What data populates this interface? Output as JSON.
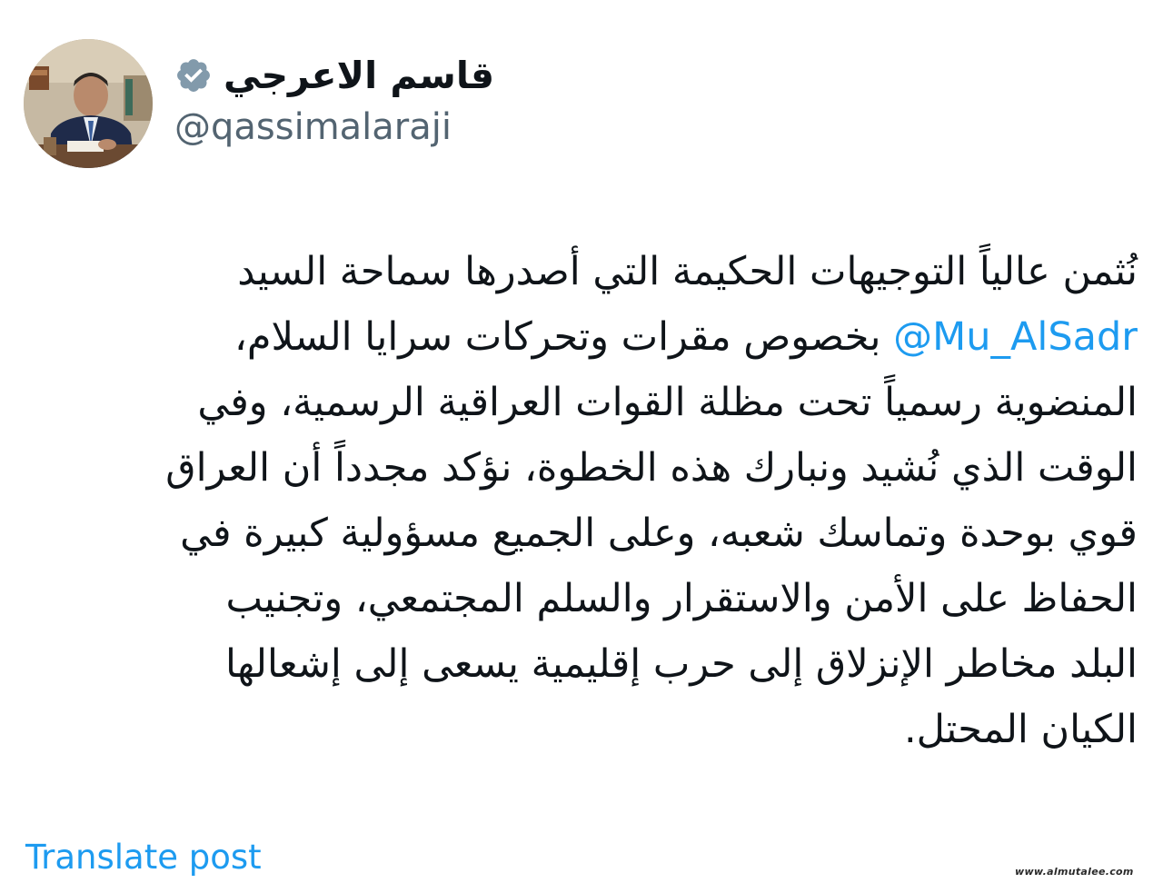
{
  "author": {
    "display_name": "قاسم الاعرجي",
    "handle": "@qassimalaraji",
    "verified": true,
    "verified_icon": "verified-badge-icon",
    "verified_color": "#829aab",
    "avatar": "avatar-photo"
  },
  "post": {
    "lines": [
      {
        "text": "نُثمن عالياً التوجيهات الحكيمة التي أصدرها سماحة السيد"
      },
      {
        "mention": "@Mu_AlSadr",
        "text": " بخصوص مقرات وتحركات سرايا السلام،"
      },
      {
        "text": "المنضوية رسمياً تحت مظلة القوات العراقية الرسمية، وفي"
      },
      {
        "text": "الوقت الذي نُشيد ونبارك هذه الخطوة، نؤكد مجدداً أن العراق"
      },
      {
        "text": "قوي بوحدة وتماسك شعبه، وعلى الجميع مسؤولية كبيرة في"
      },
      {
        "text": "الحفاظ على الأمن والاستقرار والسلم المجتمعي، وتجنيب"
      },
      {
        "text": "البلد مخاطر الإنزلاق إلى حرب إقليمية يسعى إلى إشعالها"
      },
      {
        "text": "الكيان المحتل."
      }
    ],
    "mention_color": "#1d9bf0",
    "text_color": "#0f1419"
  },
  "translate": {
    "label": "Translate post",
    "color": "#1d9bf0"
  },
  "watermark": {
    "text": "www.almutalee.com"
  }
}
